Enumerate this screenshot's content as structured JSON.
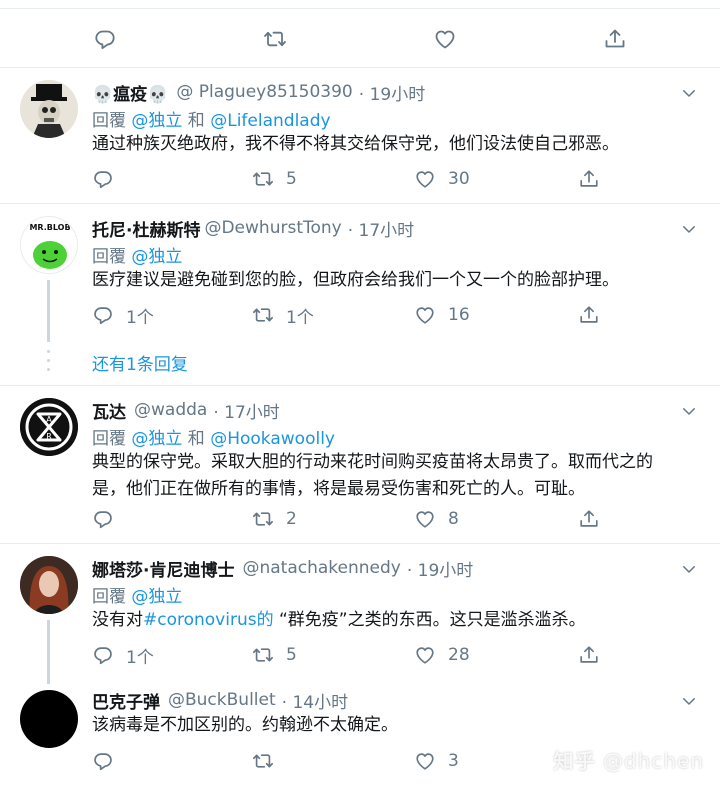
{
  "icons": {
    "reply": "reply-icon",
    "retweet": "retweet-icon",
    "like": "like-icon",
    "share": "share-icon",
    "caret": "chevron-down-icon"
  },
  "colors": {
    "link": "#1b95e0",
    "muted": "#657786",
    "divider": "#e6ecf0"
  },
  "tweets": [
    {
      "name": "💀瘟疫💀",
      "handle": "@ Plaguey85150390",
      "time": "· 19小时",
      "reply_prefix": "回覆 ",
      "reply_mention1": "@独立",
      "reply_and": " 和 ",
      "reply_mention2": "@Lifelandlady",
      "text": "通过种族灭绝政府，我不得不将其交给保守党，他们设法使自己邪恶。",
      "replies": "",
      "retweets": "5",
      "likes": "30"
    },
    {
      "name": "托尼·杜赫斯特",
      "handle": "@DewhurstTony",
      "time": "· 17小时",
      "avatar_text": "MR.BLOB",
      "reply_prefix": "回覆 ",
      "reply_mention1": "@独立",
      "text": "医疗建议是避免碰到您的脸，但政府会给我们一个又一个的脸部护理。",
      "replies": "1个",
      "retweets": "1个",
      "likes": "16",
      "more_replies": "还有1条回复"
    },
    {
      "name": "瓦达",
      "handle": "@wadda",
      "time": "· 17小时",
      "reply_prefix": "回覆 ",
      "reply_mention1": "@独立",
      "reply_and": " 和 ",
      "reply_mention2": "@Hookawoolly",
      "text_line1": "典型的保守党。采取大胆的行动来花时间购买疫苗将太昂贵了。取而代之的",
      "text_line2": "是，他们正在做所有的事情，将是最易受伤害和死亡的人。可耻。",
      "replies": "",
      "retweets": "2",
      "likes": "8"
    },
    {
      "name": "娜塔莎·肯尼迪博士",
      "handle": "@natachakennedy",
      "time": "· 19小时",
      "reply_prefix": "回覆 ",
      "reply_mention1": "@独立",
      "text_pre": "没有对",
      "hashtag": "#coronovirus的",
      "text_post": " “群免疫”之类的东西。这只是滥杀滥杀。",
      "replies": "1个",
      "retweets": "5",
      "likes": "28"
    },
    {
      "name": "巴克子弹",
      "handle": "@BuckBullet",
      "time": "· 14小时",
      "text": "该病毒是不加区别的。约翰逊不太确定。",
      "replies": "",
      "retweets": "",
      "likes": "3"
    }
  ],
  "watermark": {
    "brand": "知乎",
    "user": "@dhchen"
  }
}
